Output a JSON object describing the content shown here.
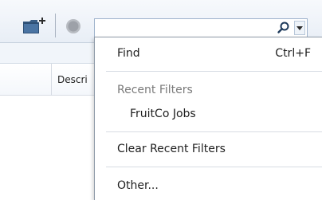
{
  "toolbar": {
    "icons": {
      "folder": "folder-add-icon",
      "stop": "stop-circle-icon",
      "search": "search-icon",
      "dropdown": "chevron-down-icon"
    },
    "search": {
      "value": "",
      "placeholder": ""
    }
  },
  "table": {
    "column_header": "Descri"
  },
  "menu": {
    "find": {
      "label": "Find",
      "shortcut": "Ctrl+F"
    },
    "recent_heading": "Recent Filters",
    "recent_items": [
      "FruitCo Jobs"
    ],
    "clear_label": "Clear Recent Filters",
    "other_label": "Other..."
  },
  "colors": {
    "toolbar_top": "#f7f9fc",
    "toolbar_bottom": "#e8eef6",
    "search_border": "#9fb3cc",
    "menu_border": "#8f9aa8",
    "heading_text": "#7a7a7a"
  }
}
